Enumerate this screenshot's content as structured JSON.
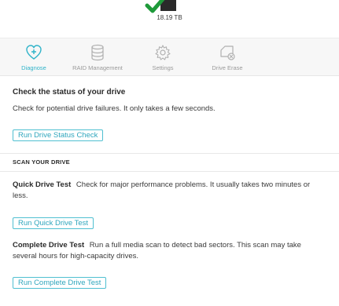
{
  "drive": {
    "size_label": "18.19 TB"
  },
  "tabs": [
    {
      "label": "Diagnose",
      "icon": "diagnose-icon",
      "active": true
    },
    {
      "label": "RAID Management",
      "icon": "raid-icon",
      "active": false
    },
    {
      "label": "Settings",
      "icon": "gear-icon",
      "active": false
    },
    {
      "label": "Drive Erase",
      "icon": "drive-erase-icon",
      "active": false
    }
  ],
  "status": {
    "title": "Check the status of your drive",
    "description": "Check for potential drive failures. It only takes a few seconds.",
    "button": "Run Drive Status Check"
  },
  "scan": {
    "section_title": "SCAN YOUR DRIVE",
    "quick": {
      "title": "Quick Drive Test",
      "description": "Check for major performance problems. It usually takes two minutes or less.",
      "button": "Run Quick Drive Test"
    },
    "complete": {
      "title": "Complete Drive Test",
      "description": "Run a full media scan to detect bad sectors. This scan may take several hours for high-capacity drives.",
      "button": "Run Complete Drive Test"
    }
  },
  "colors": {
    "accent": "#2fb3c9",
    "check": "#1e9a3a"
  }
}
